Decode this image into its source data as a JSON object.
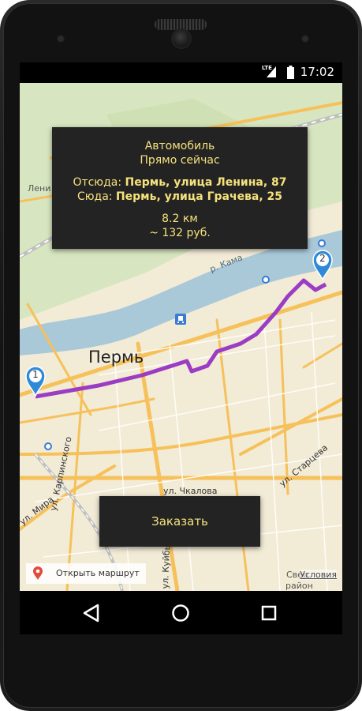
{
  "status_bar": {
    "network": "LTE",
    "time": "17:02"
  },
  "route_card": {
    "mode": "Автомобиль",
    "when": "Прямо сейчас",
    "from_label": "Отсюда:",
    "from_value": "Пермь, улица Ленина, 87",
    "to_label": "Сюда:",
    "to_value": "Пермь, улица Грачева, 25",
    "distance": "8.2 км",
    "price": "~ 132 руб."
  },
  "map": {
    "city_label": "Пермь",
    "street_labels": {
      "lenina_cut": "Лени",
      "kama": "р. Кама",
      "chkalova": "ул. Чкалова",
      "mira": "ул. Мира",
      "karpinskogo": "ул. Карпинского",
      "startseva": "ул. Старцева",
      "kuibysheva": "ул. Куйбышева",
      "sverd": "Свер",
      "raion": "район"
    },
    "marker_start": "1",
    "marker_end": "2",
    "route_color": "#9b3cc4",
    "water_color": "#a9c8d8",
    "road_color": "#f6c15a"
  },
  "order_button": {
    "label": "Заказать"
  },
  "open_route": {
    "label": "Открыть маршрут",
    "icon": "map-pin-icon"
  },
  "terms": {
    "label": "Условия"
  },
  "nav": {
    "back_icon": "back-triangle-icon",
    "home_icon": "home-circle-icon",
    "recent_icon": "recent-square-icon"
  }
}
